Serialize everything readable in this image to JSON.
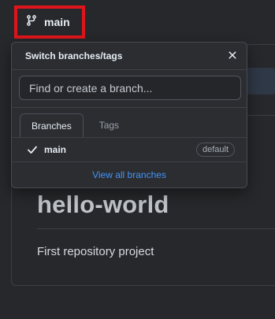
{
  "branch_button": {
    "label": "main"
  },
  "dropdown": {
    "title": "Switch branches/tags",
    "search": {
      "placeholder": "Find or create a branch...",
      "value": ""
    },
    "tabs": [
      {
        "label": "Branches",
        "active": true
      },
      {
        "label": "Tags",
        "active": false
      }
    ],
    "branches": [
      {
        "name": "main",
        "badge": "default",
        "selected": true
      }
    ],
    "footer_link": "View all branches"
  },
  "repo": {
    "title": "hello-world",
    "description": "First repository project"
  },
  "colors": {
    "background": "#26282b",
    "panel": "#2b2d31",
    "highlight_box": "#e0151b",
    "link": "#4493f8"
  },
  "icons": {
    "branch": "git-branch-icon",
    "close": "close-icon",
    "selected": "check-icon"
  }
}
